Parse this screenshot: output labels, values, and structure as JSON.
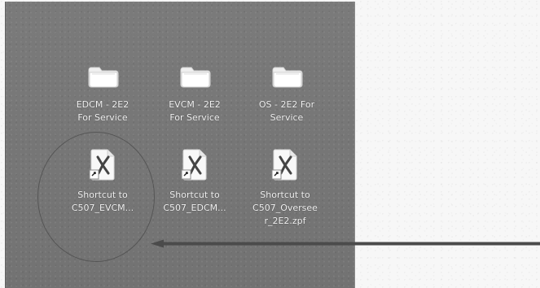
{
  "desktop": {
    "items": [
      {
        "type": "folder",
        "label_lines": [
          "EDCM - 2E2",
          "For Service"
        ]
      },
      {
        "type": "folder",
        "label_lines": [
          "EVCM - 2E2",
          "For Service"
        ]
      },
      {
        "type": "folder",
        "label_lines": [
          "OS - 2E2 For",
          "Service"
        ]
      },
      {
        "type": "shortcut",
        "label_lines": [
          "Shortcut to",
          "C507_EVCM..."
        ]
      },
      {
        "type": "shortcut",
        "label_lines": [
          "Shortcut to",
          "C507_EDCM..."
        ]
      },
      {
        "type": "shortcut",
        "label_lines": [
          "Shortcut to",
          "C507_Oversee",
          "r_2E2.zpf"
        ]
      }
    ]
  },
  "annotation": {
    "circle_color": "#4b4b4b",
    "arrow_color": "#4b4b4b"
  }
}
